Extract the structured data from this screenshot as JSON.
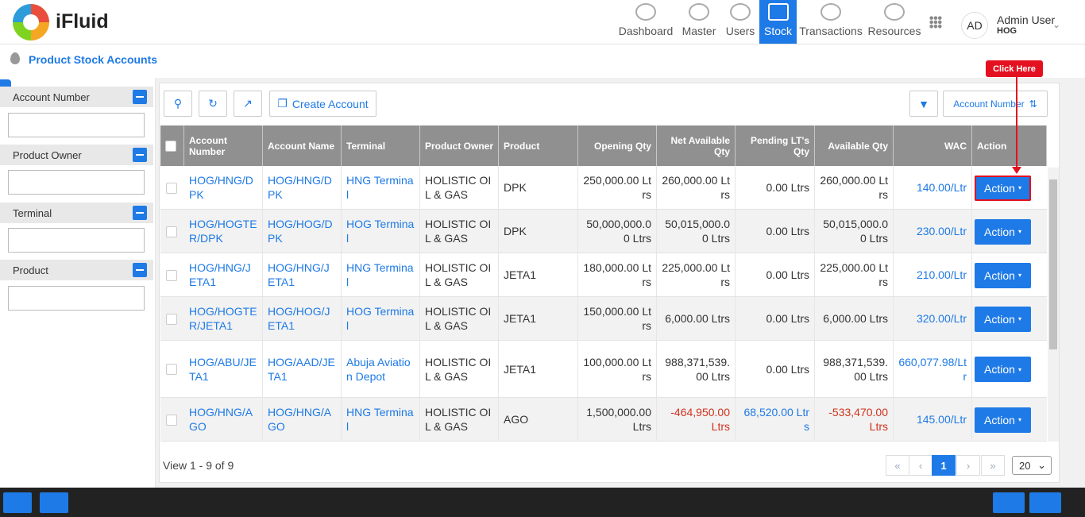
{
  "app": {
    "brand": "iFluid"
  },
  "nav": [
    {
      "label": "Dashboard",
      "icon": "dashboard-icon"
    },
    {
      "label": "Master",
      "icon": "building-icon"
    },
    {
      "label": "Users",
      "icon": "users-icon"
    },
    {
      "label": "Stock",
      "icon": "stock-icon",
      "active": true
    },
    {
      "label": "Transactions",
      "icon": "transactions-icon"
    },
    {
      "label": "Resources",
      "icon": "resources-icon"
    }
  ],
  "user": {
    "initials": "AD",
    "name": "Admin User",
    "org": "HOG"
  },
  "page": {
    "title": "Product Stock Accounts"
  },
  "filters": [
    {
      "label": "Account Number",
      "value": ""
    },
    {
      "label": "Product Owner",
      "value": ""
    },
    {
      "label": "Terminal",
      "value": ""
    },
    {
      "label": "Product",
      "value": ""
    }
  ],
  "toolbar": {
    "create_label": "Create Account",
    "sort_label": "Account Number"
  },
  "callout": {
    "text": "Click Here"
  },
  "table": {
    "columns": [
      "Account Number",
      "Account Name",
      "Terminal",
      "Product Owner",
      "Product",
      "Opening Qty",
      "Net Available Qty",
      "Pending LT's Qty",
      "Available Qty",
      "WAC",
      "Action"
    ],
    "rows": [
      {
        "account_number": "HOG/HNG/DPK",
        "account_name": "HOG/HNG/DPK",
        "terminal": "HNG Terminal",
        "owner": "HOLISTIC OIL & GAS",
        "product": "DPK",
        "opening": "250,000.00 Ltrs",
        "net": "260,000.00 Ltrs",
        "pending": "0.00 Ltrs",
        "available": "260,000.00 Ltrs",
        "wac": "140.00/Ltr",
        "action": "Action"
      },
      {
        "account_number": "HOG/HOGTER/DPK",
        "account_name": "HOG/HOG/DPK",
        "terminal": "HOG Terminal",
        "owner": "HOLISTIC OIL & GAS",
        "product": "DPK",
        "opening": "50,000,000.00 Ltrs",
        "net": "50,015,000.00 Ltrs",
        "pending": "0.00 Ltrs",
        "available": "50,015,000.00 Ltrs",
        "wac": "230.00/Ltr",
        "action": "Action"
      },
      {
        "account_number": "HOG/HNG/JETA1",
        "account_name": "HOG/HNG/JETA1",
        "terminal": "HNG Terminal",
        "owner": "HOLISTIC OIL & GAS",
        "product": "JETA1",
        "opening": "180,000.00 Ltrs",
        "net": "225,000.00 Ltrs",
        "pending": "0.00 Ltrs",
        "available": "225,000.00 Ltrs",
        "wac": "210.00/Ltr",
        "action": "Action"
      },
      {
        "account_number": "HOG/HOGTER/JETA1",
        "account_name": "HOG/HOG/JETA1",
        "terminal": "HOG Terminal",
        "owner": "HOLISTIC OIL & GAS",
        "product": "JETA1",
        "opening": "150,000.00 Ltrs",
        "net": "6,000.00 Ltrs",
        "pending": "0.00 Ltrs",
        "available": "6,000.00 Ltrs",
        "wac": "320.00/Ltr",
        "action": "Action"
      },
      {
        "account_number": "HOG/ABU/JETA1",
        "account_name": "HOG/AAD/JETA1",
        "terminal": "Abuja Aviation Depot",
        "owner": "HOLISTIC OIL & GAS",
        "product": "JETA1",
        "opening": "100,000.00 Ltrs",
        "net": "988,371,539.00 Ltrs",
        "pending": "0.00 Ltrs",
        "available": "988,371,539.00 Ltrs",
        "wac": "660,077.98/Ltr",
        "action": "Action"
      },
      {
        "account_number": "HOG/HNG/AGO",
        "account_name": "HOG/HNG/AGO",
        "terminal": "HNG Terminal",
        "owner": "HOLISTIC OIL & GAS",
        "product": "AGO",
        "opening": "1,500,000.00 Ltrs",
        "net": "-464,950.00 Ltrs",
        "pending": "68,520.00 Ltrs",
        "available": "-533,470.00 Ltrs",
        "wac": "145.00/Ltr",
        "action": "Action"
      }
    ]
  },
  "pager": {
    "summary": "View 1 - 9 of 9",
    "current": "1",
    "first": "«",
    "prev": "‹",
    "next": "›",
    "last": "»",
    "page_size": "20"
  },
  "colors": {
    "accent": "#1e7ae6",
    "header": "#909090",
    "negative": "#d0321e",
    "callout": "#e3101f"
  }
}
